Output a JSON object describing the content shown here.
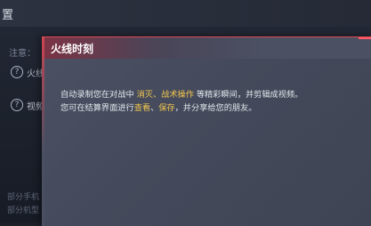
{
  "background": {
    "title": "置",
    "note": "注意：",
    "settings_rows": [
      {
        "label": "火线",
        "icon": "question-circle-icon"
      },
      {
        "label": "视频",
        "icon": "question-circle-icon"
      }
    ],
    "footnotes": [
      "部分手机",
      "部分机型"
    ]
  },
  "dialog": {
    "title": "火线时刻",
    "accent_color": "#e04b57",
    "highlight_color": "#f3c64f",
    "line1": {
      "prefix": "自动录制您在对战中 ",
      "highlight1": "消灭",
      "sep": "、",
      "highlight2": "战术操作",
      "suffix": " 等精彩瞬间，并剪辑成视频。"
    },
    "line2": {
      "prefix": "您可在结算界面进行",
      "highlight1": "查看",
      "sep": "、",
      "highlight2": "保存",
      "suffix": "，并分享给您的朋友。"
    }
  }
}
